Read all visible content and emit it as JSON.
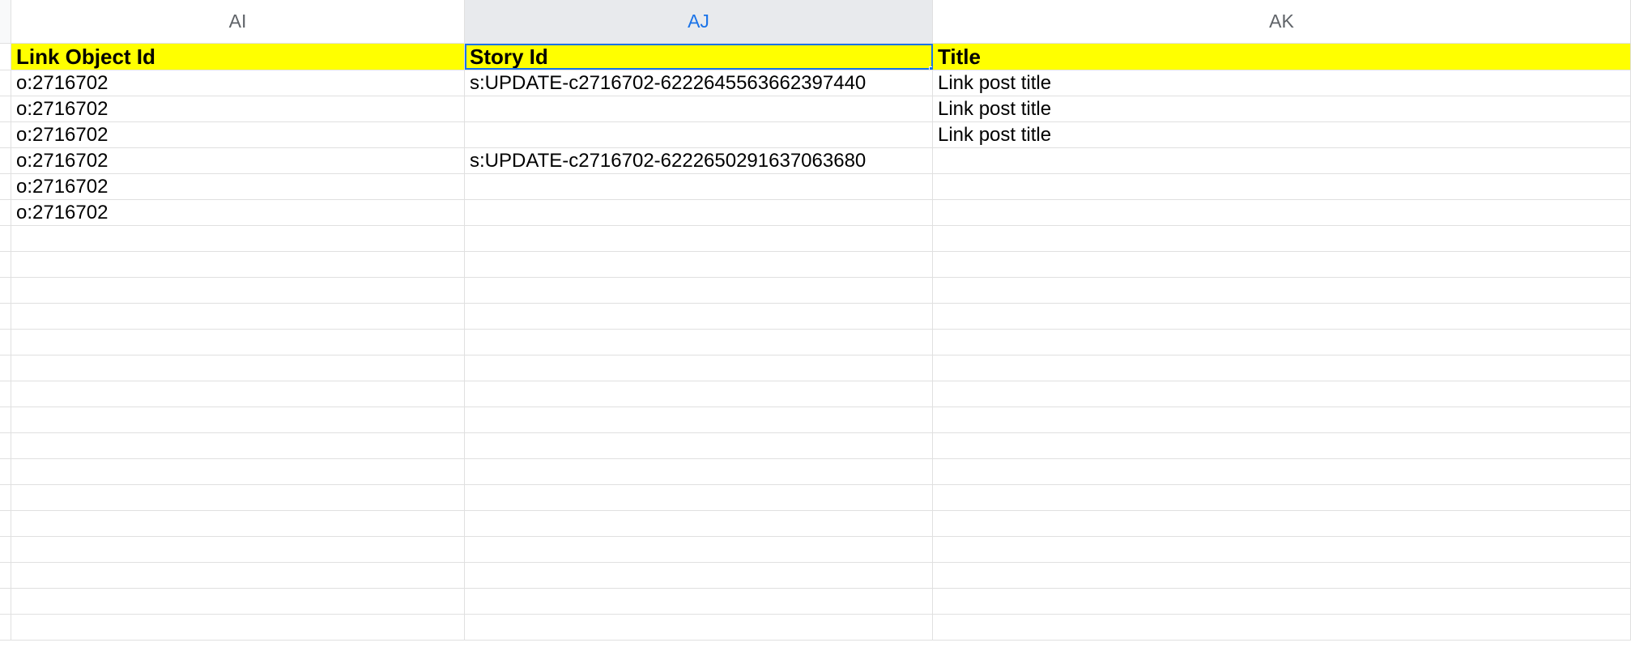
{
  "columns": {
    "AI": "AI",
    "AJ": "AJ",
    "AK": "AK"
  },
  "headers": {
    "AI": "Link Object Id",
    "AJ": "Story Id",
    "AK": "Title"
  },
  "rows": [
    {
      "AI": "o:2716702",
      "AJ": "s:UPDATE-c2716702-6222645563662397440",
      "AK": "Link post title"
    },
    {
      "AI": "o:2716702",
      "AJ": "",
      "AK": "Link post title"
    },
    {
      "AI": "o:2716702",
      "AJ": "",
      "AK": "Link post title"
    },
    {
      "AI": "o:2716702",
      "AJ": "s:UPDATE-c2716702-6222650291637063680",
      "AK": ""
    },
    {
      "AI": "o:2716702",
      "AJ": "",
      "AK": ""
    },
    {
      "AI": "o:2716702",
      "AJ": "",
      "AK": ""
    },
    {
      "AI": "",
      "AJ": "",
      "AK": ""
    },
    {
      "AI": "",
      "AJ": "",
      "AK": ""
    },
    {
      "AI": "",
      "AJ": "",
      "AK": ""
    },
    {
      "AI": "",
      "AJ": "",
      "AK": ""
    },
    {
      "AI": "",
      "AJ": "",
      "AK": ""
    },
    {
      "AI": "",
      "AJ": "",
      "AK": ""
    },
    {
      "AI": "",
      "AJ": "",
      "AK": ""
    },
    {
      "AI": "",
      "AJ": "",
      "AK": ""
    },
    {
      "AI": "",
      "AJ": "",
      "AK": ""
    },
    {
      "AI": "",
      "AJ": "",
      "AK": ""
    },
    {
      "AI": "",
      "AJ": "",
      "AK": ""
    },
    {
      "AI": "",
      "AJ": "",
      "AK": ""
    },
    {
      "AI": "",
      "AJ": "",
      "AK": ""
    },
    {
      "AI": "",
      "AJ": "",
      "AK": ""
    },
    {
      "AI": "",
      "AJ": "",
      "AK": ""
    },
    {
      "AI": "",
      "AJ": "",
      "AK": ""
    }
  ]
}
